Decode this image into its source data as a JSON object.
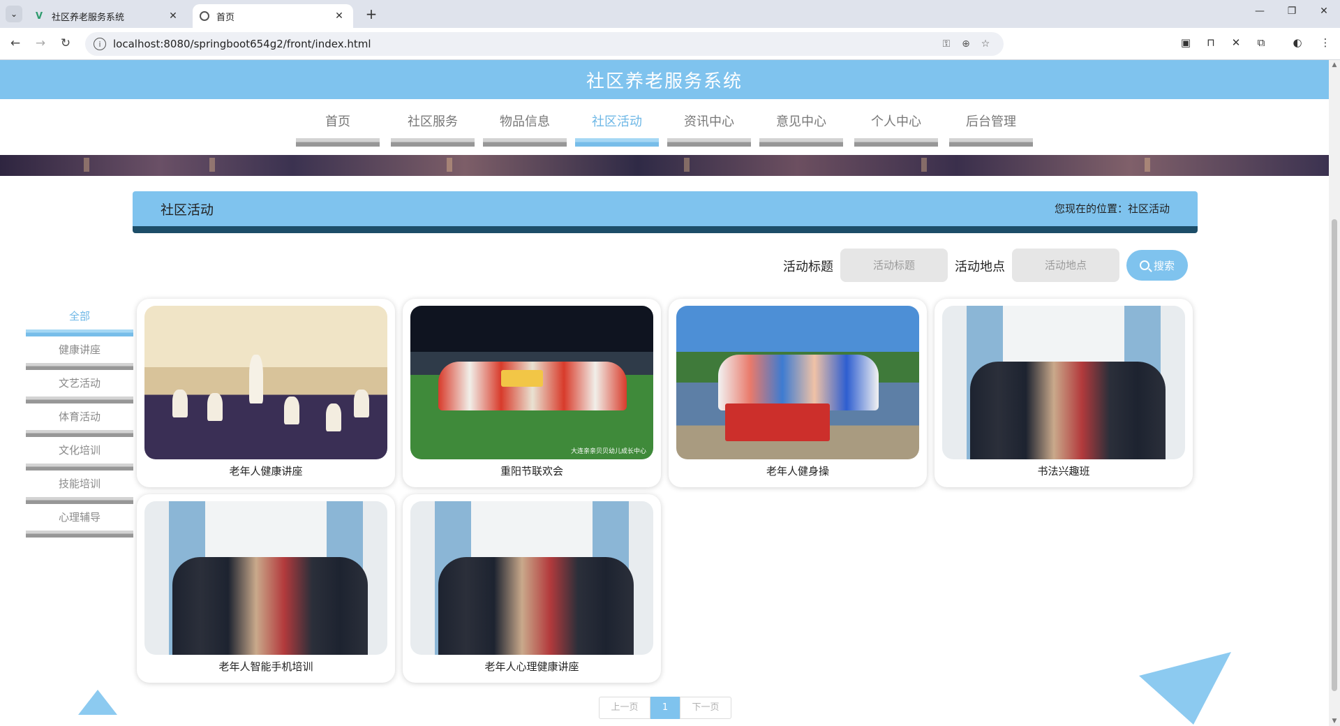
{
  "browser": {
    "tabs": [
      {
        "title": "社区养老服务系统",
        "active": false
      },
      {
        "title": "首页",
        "active": true
      }
    ],
    "url": "localhost:8080/springboot654g2/front/index.html"
  },
  "site": {
    "title": "社区养老服务系统",
    "nav": [
      {
        "label": "首页"
      },
      {
        "label": "社区服务"
      },
      {
        "label": "物品信息"
      },
      {
        "label": "社区活动",
        "active": true
      },
      {
        "label": "资讯中心"
      },
      {
        "label": "意见中心"
      },
      {
        "label": "个人中心"
      },
      {
        "label": "后台管理"
      }
    ]
  },
  "page": {
    "heading": "社区活动",
    "breadcrumb_prefix": "您现在的位置：",
    "breadcrumb_current": "社区活动"
  },
  "search": {
    "title_label": "活动标题",
    "title_placeholder": "活动标题",
    "location_label": "活动地点",
    "location_placeholder": "活动地点",
    "button_label": "搜索"
  },
  "sidebar": {
    "items": [
      {
        "label": "全部",
        "active": true
      },
      {
        "label": "健康讲座"
      },
      {
        "label": "文艺活动"
      },
      {
        "label": "体育活动"
      },
      {
        "label": "文化培训"
      },
      {
        "label": "技能培训"
      },
      {
        "label": "心理辅导"
      }
    ]
  },
  "activities": [
    {
      "title": "老年人健康讲座",
      "scene": "indoor-lecture"
    },
    {
      "title": "重阳节联欢会",
      "scene": "stadium-group",
      "watermark": "大连亲亲贝贝幼儿成长中心"
    },
    {
      "title": "老年人健身操",
      "scene": "lakeside-group"
    },
    {
      "title": "书法兴趣班",
      "scene": "office-group"
    },
    {
      "title": "老年人智能手机培训",
      "scene": "office-group"
    },
    {
      "title": "老年人心理健康讲座",
      "scene": "office-group"
    }
  ],
  "pagination": {
    "prev_label": "上一页",
    "current": "1",
    "next_label": "下一页"
  },
  "colors": {
    "accent": "#7fc3ee",
    "dark_accent": "#1c4d68"
  }
}
